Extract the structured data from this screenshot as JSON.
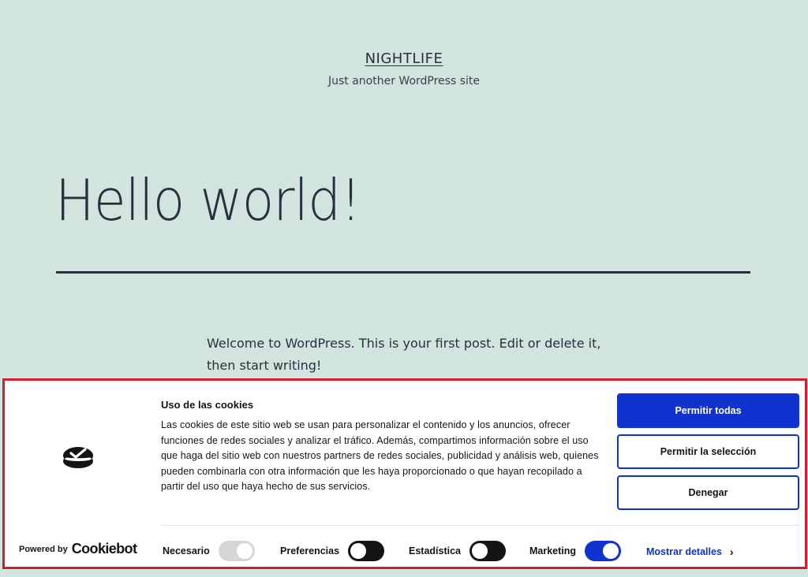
{
  "site": {
    "title": "NIGHTLIFE",
    "description": "Just another WordPress site"
  },
  "post": {
    "title": "Hello world!",
    "content": "Welcome to WordPress. This is your first post. Edit or delete it, then start writing!"
  },
  "cookie_banner": {
    "heading": "Uso de las cookies",
    "body": "Las cookies de este sitio web se usan para personalizar el contenido y los anuncios, ofrecer funciones de redes sociales y analizar el tráfico. Además, compartimos información sobre el uso que haga del sitio web con nuestros partners de redes sociales, publicidad y análisis web, quienes pueden combinarla con otra información que les haya proporcionado o que hayan recopilado a partir del uso que haya hecho de sus servicios.",
    "buttons": {
      "allow_all": "Permitir todas",
      "allow_selection": "Permitir la selección",
      "deny": "Denegar"
    },
    "powered_by": "Powered by",
    "brand": "Cookiebot",
    "toggles": [
      {
        "label": "Necesario",
        "state": "on-disabled"
      },
      {
        "label": "Preferencias",
        "state": "off"
      },
      {
        "label": "Estadística",
        "state": "off"
      },
      {
        "label": "Marketing",
        "state": "on"
      }
    ],
    "details_link": "Mostrar detalles",
    "colors": {
      "accent": "#1032cf",
      "border": "#d0202f",
      "page_background": "#d1e4dd"
    }
  }
}
